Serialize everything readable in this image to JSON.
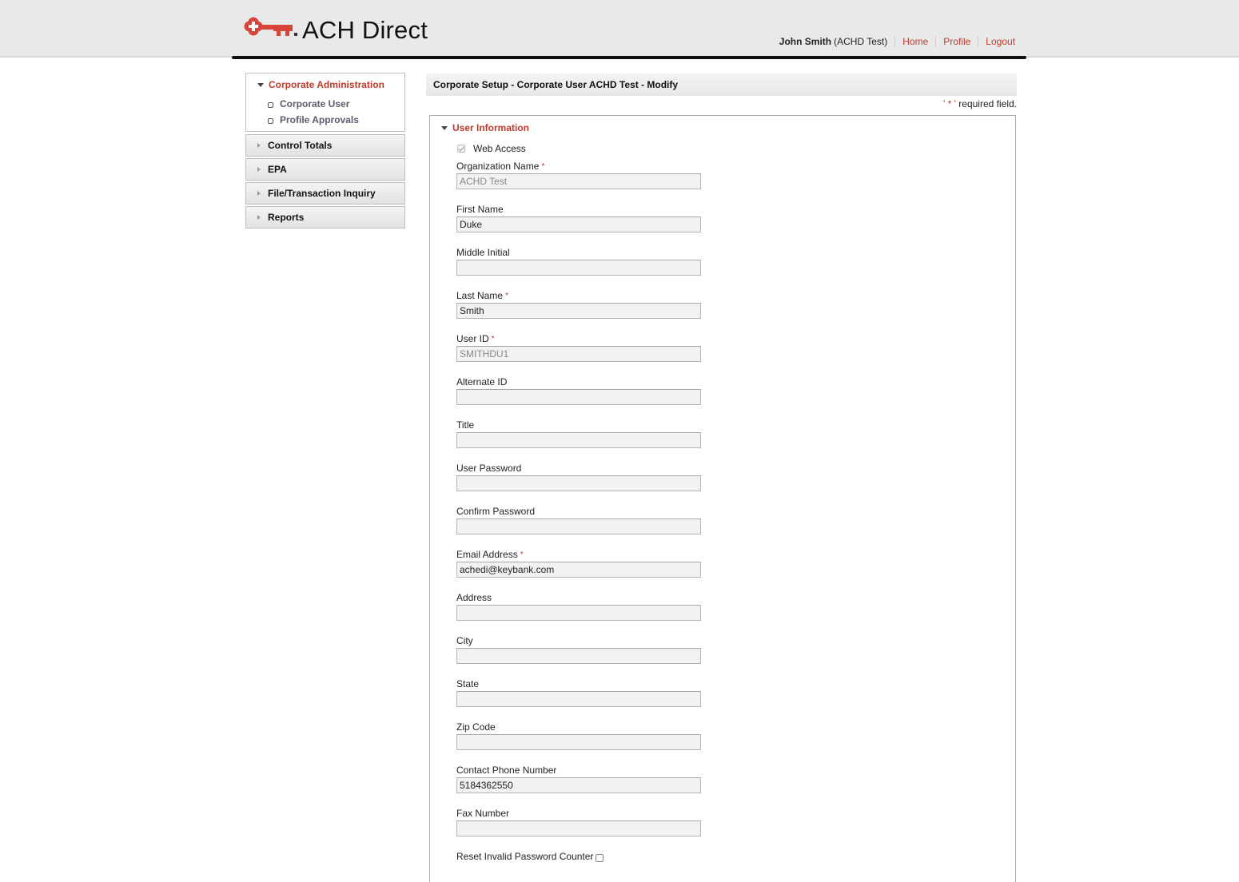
{
  "header": {
    "app_title": "ACH Direct",
    "logo_icon": "key-icon",
    "user_name": "John Smith",
    "user_org": "(ACHD Test)",
    "links": [
      {
        "label": "Home"
      },
      {
        "label": "Profile"
      },
      {
        "label": "Logout"
      }
    ],
    "accent_color": "#c0392b"
  },
  "sidebar": {
    "open_section": {
      "label": "Corporate Administration",
      "icon": "triangle-down-icon",
      "items": [
        {
          "label": "Corporate User",
          "icon": "square-bullet-icon"
        },
        {
          "label": "Profile Approvals",
          "icon": "square-bullet-icon"
        }
      ]
    },
    "sections": [
      {
        "label": "Control Totals",
        "icon": "triangle-right-icon"
      },
      {
        "label": "EPA",
        "icon": "triangle-right-icon"
      },
      {
        "label": "File/Transaction Inquiry",
        "icon": "triangle-right-icon"
      },
      {
        "label": "Reports",
        "icon": "triangle-right-icon"
      }
    ]
  },
  "main": {
    "page_title": "Corporate Setup - Corporate User ACHD Test - Modify",
    "required_note_prefix": "' ",
    "required_note_star": "*",
    "required_note_suffix": " ' required field.",
    "panel_title": "User Information",
    "web_access": {
      "label": "Web Access",
      "checked": true,
      "disabled": true
    },
    "fields": [
      {
        "label": "Organization Name",
        "required": true,
        "value": "ACHD Test",
        "readonly": true
      },
      {
        "label": "First Name",
        "required": false,
        "value": "Duke",
        "readonly": false
      },
      {
        "label": "Middle Initial",
        "required": false,
        "value": "",
        "readonly": false
      },
      {
        "label": "Last Name",
        "required": true,
        "value": "Smith",
        "readonly": false
      },
      {
        "label": "User ID",
        "required": true,
        "value": "SMITHDU1",
        "readonly": true
      },
      {
        "label": "Alternate ID",
        "required": false,
        "value": "",
        "readonly": false
      },
      {
        "label": "Title",
        "required": false,
        "value": "",
        "readonly": false
      },
      {
        "label": "User Password",
        "required": false,
        "value": "",
        "readonly": false
      },
      {
        "label": "Confirm Password",
        "required": false,
        "value": "",
        "readonly": false
      },
      {
        "label": "Email Address",
        "required": true,
        "value": "achedi@keybank.com",
        "readonly": false
      },
      {
        "label": "Address",
        "required": false,
        "value": "",
        "readonly": false
      },
      {
        "label": "City",
        "required": false,
        "value": "",
        "readonly": false
      },
      {
        "label": "State",
        "required": false,
        "value": "",
        "readonly": false
      },
      {
        "label": "Zip Code",
        "required": false,
        "value": "",
        "readonly": false
      },
      {
        "label": "Contact Phone Number",
        "required": false,
        "value": "5184362550",
        "readonly": false
      },
      {
        "label": "Fax Number",
        "required": false,
        "value": "",
        "readonly": false
      }
    ],
    "required_star": "*",
    "reset_counter": {
      "label": "Reset Invalid Password Counter",
      "checked": false
    }
  }
}
